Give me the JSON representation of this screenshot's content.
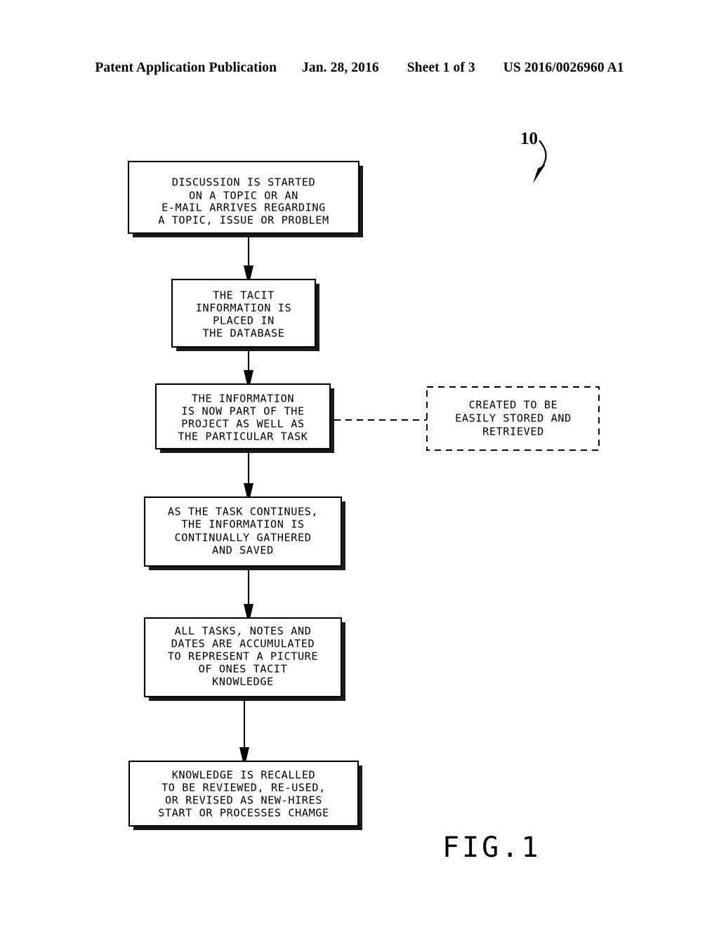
{
  "header": {
    "publication_label": "Patent Application Publication",
    "date": "Jan. 28, 2016",
    "sheet": "Sheet 1 of 3",
    "document_number": "US 2016/0026960 A1"
  },
  "figure": {
    "caption": "FIG.1",
    "reference_numeral": "10"
  },
  "flowchart": {
    "nodes": [
      {
        "id": "discussion-started",
        "style": "solid-shadow",
        "lines": [
          "DISCUSSION IS STARTED",
          "ON A TOPIC OR AN",
          "E-MAIL ARRIVES REGARDING",
          "A TOPIC, ISSUE OR PROBLEM"
        ]
      },
      {
        "id": "tacit-information-placed",
        "style": "solid-shadow",
        "lines": [
          "THE TACIT",
          "INFORMATION IS",
          "PLACED IN",
          "THE DATABASE"
        ]
      },
      {
        "id": "information-part-of-project",
        "style": "solid-shadow",
        "lines": [
          "THE INFORMATION",
          "IS NOW PART OF THE",
          "PROJECT AS WELL AS",
          "THE PARTICULAR TASK"
        ]
      },
      {
        "id": "task-continues-gathered",
        "style": "solid-shadow",
        "lines": [
          "AS THE TASK CONTINUES,",
          "THE INFORMATION IS",
          "CONTINUALLY GATHERED",
          "AND SAVED"
        ]
      },
      {
        "id": "tasks-notes-dates-accumulated",
        "style": "solid-shadow",
        "lines": [
          "ALL TASKS, NOTES AND",
          "DATES ARE ACCUMULATED",
          "TO REPRESENT A PICTURE",
          "OF ONES TACIT",
          "KNOWLEDGE"
        ]
      },
      {
        "id": "knowledge-recalled",
        "style": "solid-shadow",
        "lines": [
          "KNOWLEDGE IS RECALLED",
          "TO BE REVIEWED, RE-USED,",
          "OR REVISED AS NEW-HIRES",
          "START OR PROCESSES CHAMGE"
        ]
      }
    ],
    "annotations": [
      {
        "id": "created-to-be-stored",
        "style": "dashed",
        "attached_to": "information-part-of-project",
        "lines": [
          "CREATED TO BE",
          "EASILY STORED AND",
          "RETRIEVED"
        ]
      }
    ]
  }
}
